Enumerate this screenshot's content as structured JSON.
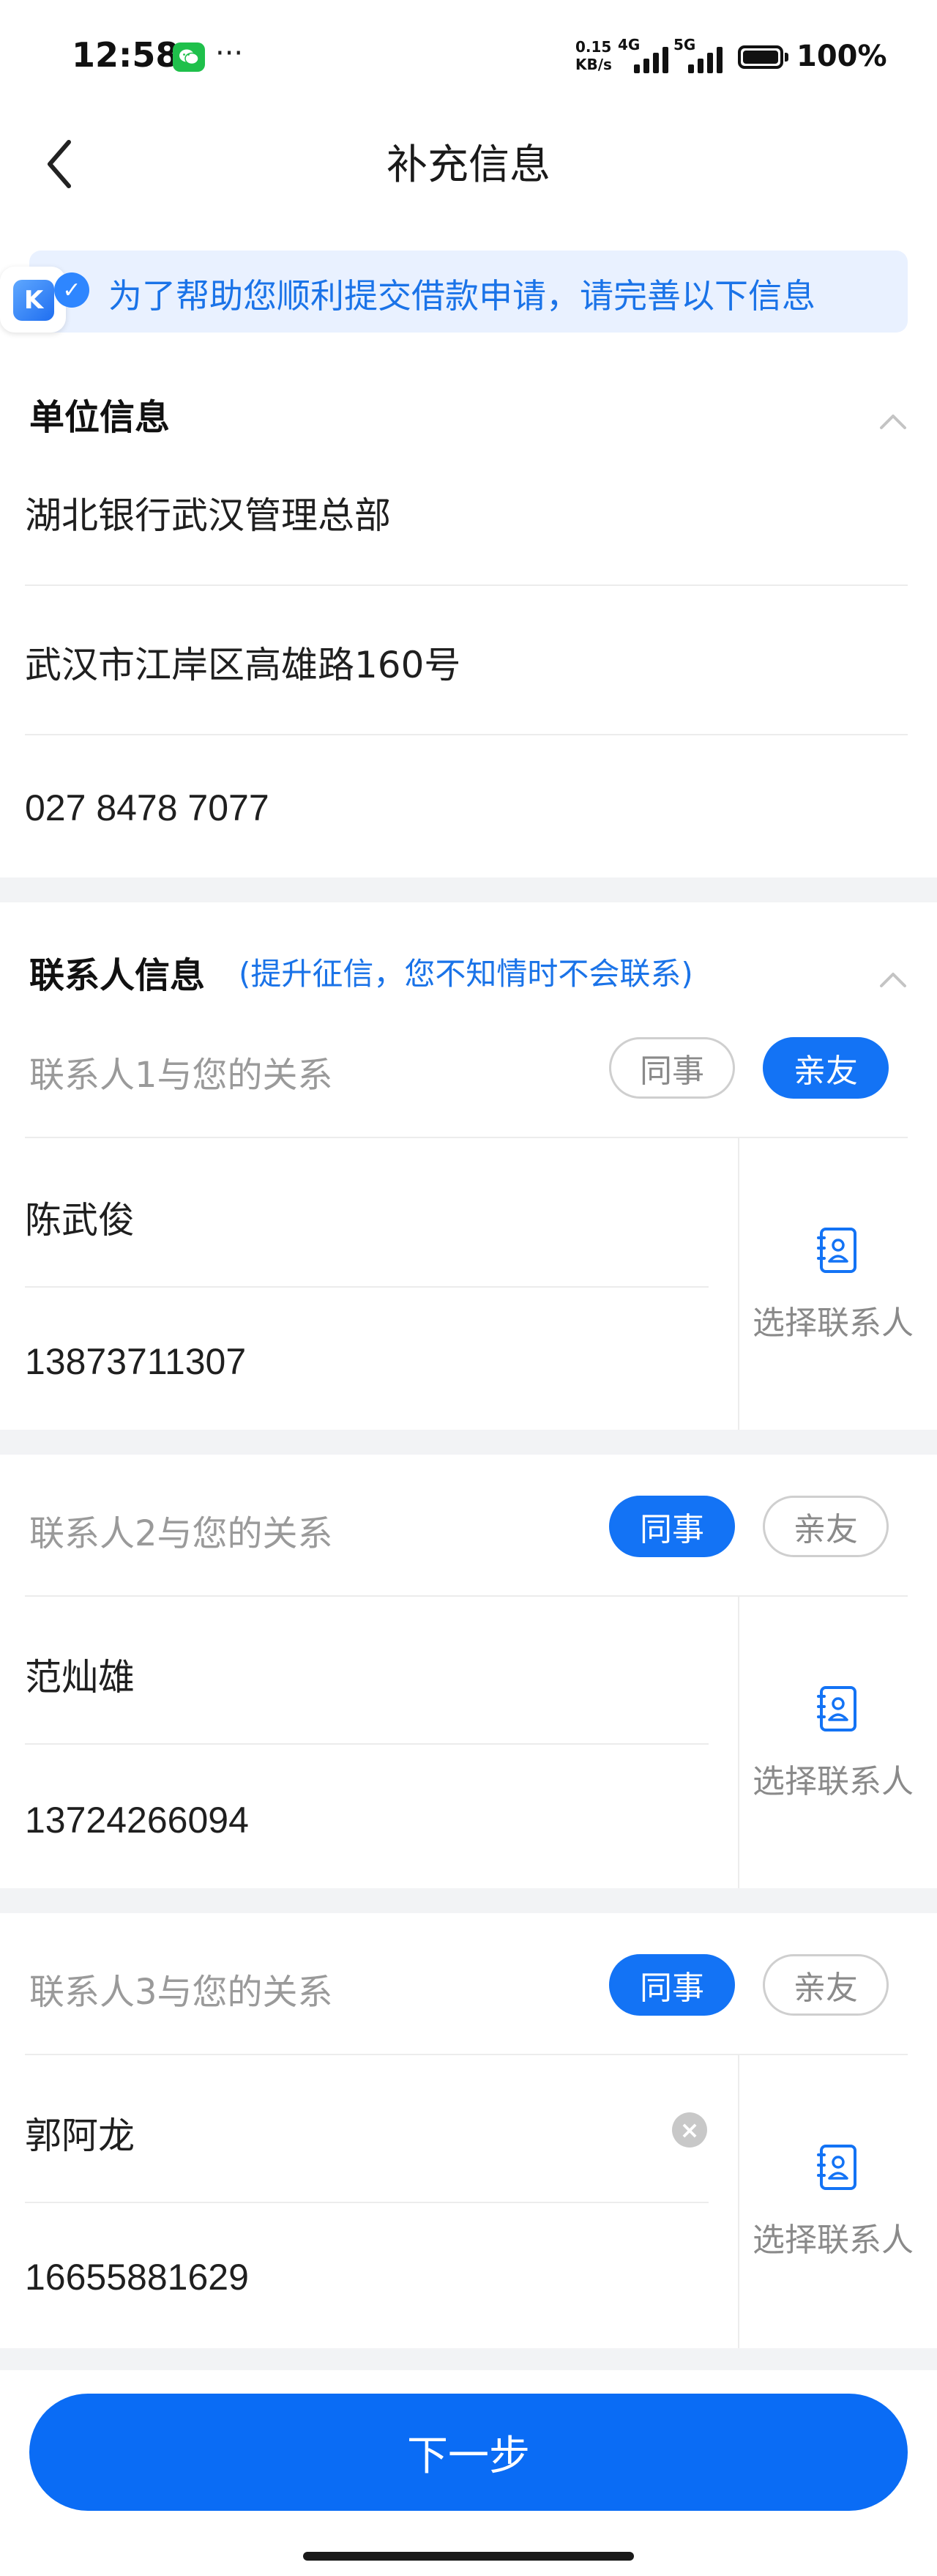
{
  "status_bar": {
    "time": "12:58",
    "dots": "···",
    "speed_value": "0.15",
    "speed_unit": "KB/s",
    "net1": "4G",
    "net2": "5G",
    "battery": "100%",
    "icons": [
      "wechat-icon",
      "signal-icon",
      "battery-icon"
    ]
  },
  "header": {
    "title": "补充信息",
    "back_icon": "chevron-left-icon"
  },
  "banner": {
    "text": "为了帮助您顺利提交借款申请，请完善以下信息",
    "logo_letter": "K",
    "check": "✓"
  },
  "company": {
    "title": "单位信息",
    "name": "湖北银行武汉管理总部",
    "address": "武汉市江岸区高雄路160号",
    "phone": "027 8478 7077"
  },
  "contacts": {
    "title": "联系人信息",
    "subtitle": "(提升征信，您不知情时不会联系)",
    "pick_label": "选择联系人",
    "chip_colleague": "同事",
    "chip_family": "亲友",
    "items": [
      {
        "relation_label": "联系人1与您的关系",
        "selected": "亲友",
        "name": "陈武俊",
        "phone": "13873711307"
      },
      {
        "relation_label": "联系人2与您的关系",
        "selected": "同事",
        "name": "范灿雄",
        "phone": "13724266094"
      },
      {
        "relation_label": "联系人3与您的关系",
        "selected": "同事",
        "name": "郭阿龙",
        "phone": "16655881629"
      }
    ]
  },
  "footer": {
    "next_label": "下一步"
  },
  "colors": {
    "accent": "#1373f5",
    "banner_bg": "#e9f1ff",
    "band": "#f2f3f5",
    "muted": "#9a9a9a"
  }
}
